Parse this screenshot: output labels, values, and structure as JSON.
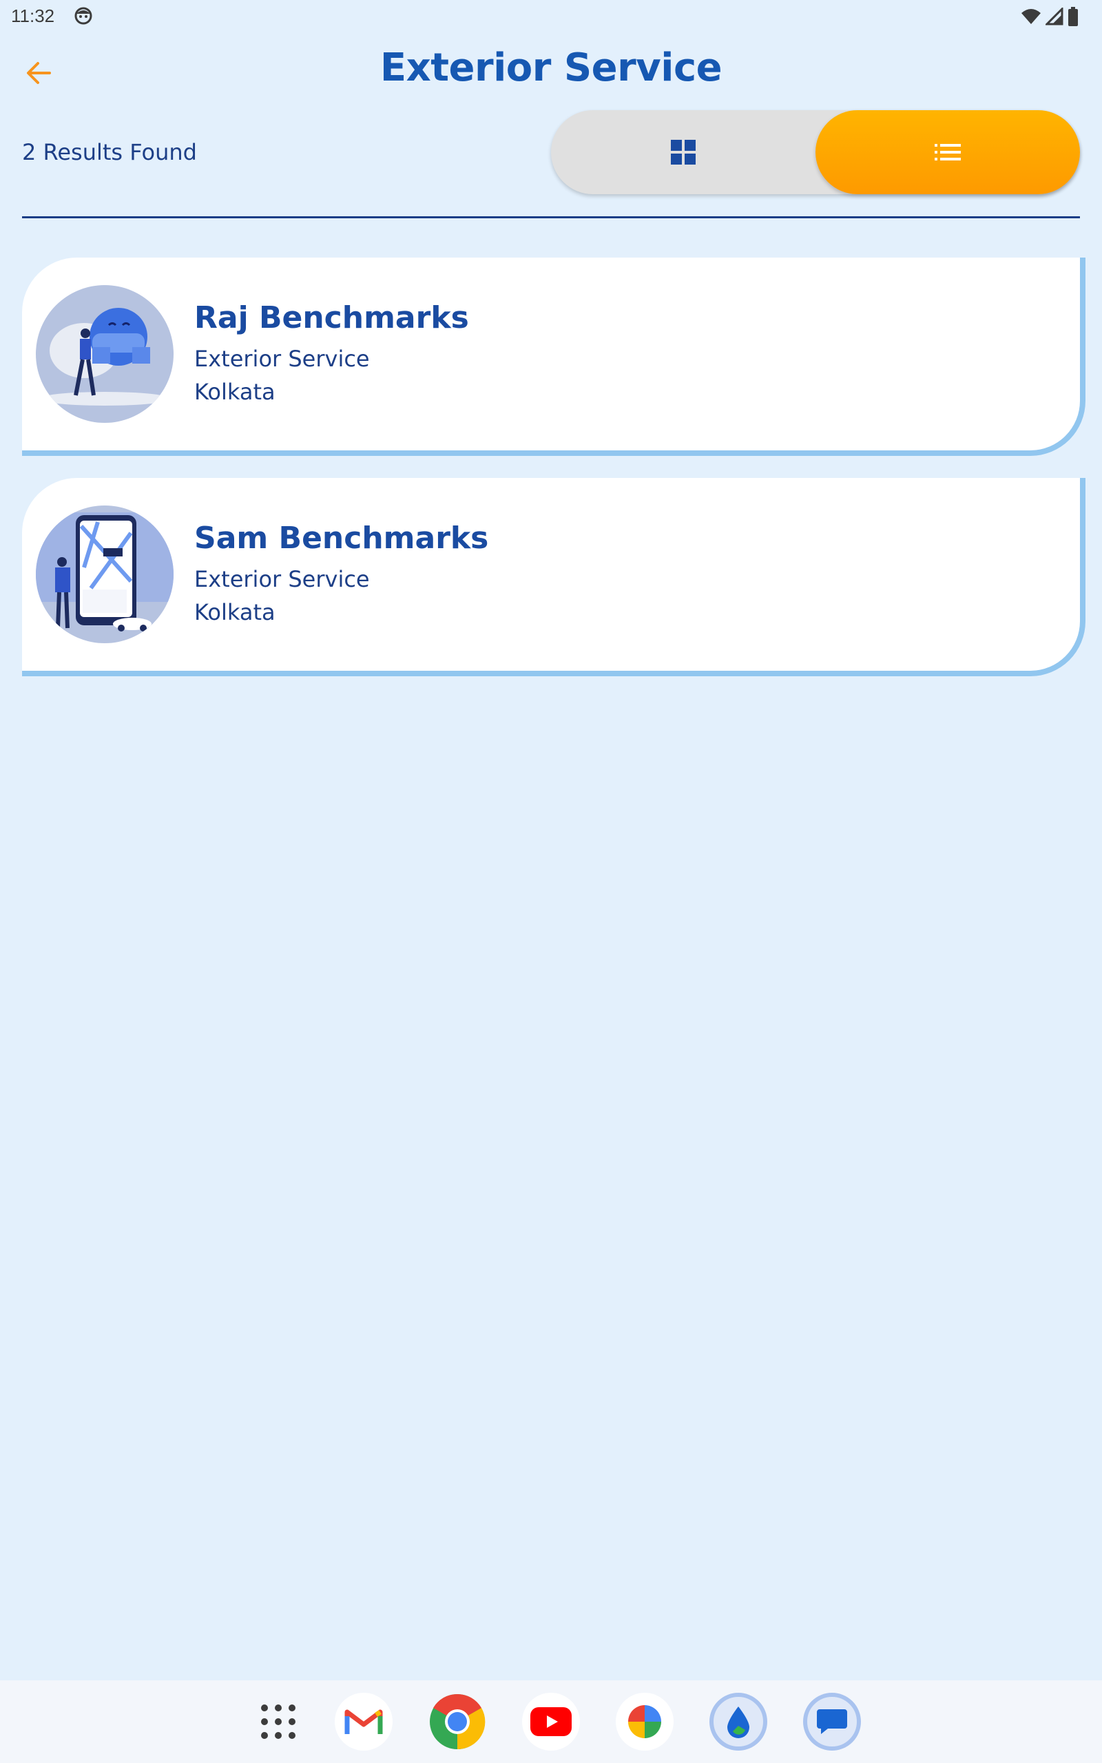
{
  "status_bar": {
    "time": "11:32"
  },
  "header": {
    "title": "Exterior Service"
  },
  "results_label": "2 Results Found",
  "view_toggle": {
    "options": [
      "grid",
      "list"
    ],
    "selected": "list"
  },
  "listings": [
    {
      "name": "Raj Benchmarks",
      "service": "Exterior Service",
      "city": "Kolkata"
    },
    {
      "name": "Sam Benchmarks",
      "service": "Exterior Service",
      "city": "Kolkata"
    }
  ],
  "dock": {
    "apps": [
      "app-drawer-icon",
      "gmail-icon",
      "chrome-icon",
      "youtube-icon",
      "photos-icon",
      "water-drop-app-icon",
      "messages-icon"
    ]
  },
  "colors": {
    "background": "#e3f0fc",
    "title": "#1658b2",
    "accent_orange": "#fe9a00",
    "text_navy": "#1d3f87",
    "card_border": "#91c6ef"
  }
}
